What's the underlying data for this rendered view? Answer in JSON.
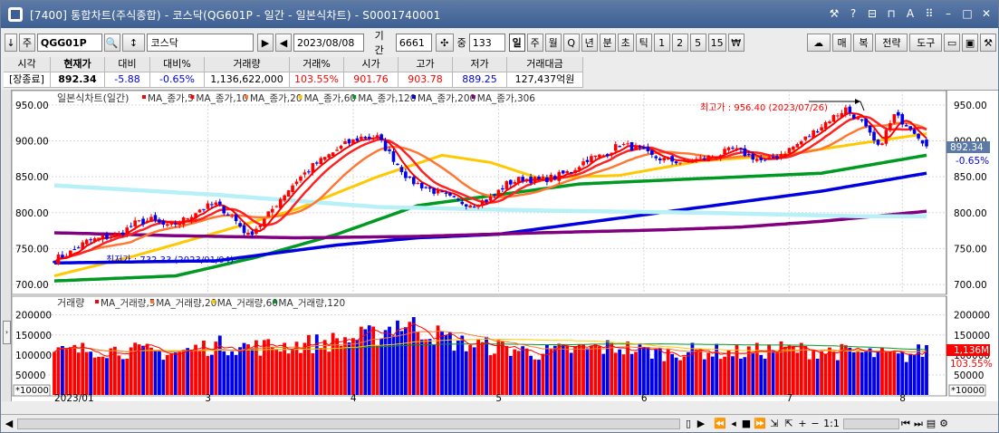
{
  "window": {
    "title": "[7400] 통합차트(주식종합) - 코스닥(QG601P - 일간 - 일본식차트) - S0001740001",
    "title_buttons": [
      "⚒",
      "?",
      "⊟",
      "⊓",
      "A",
      "⠿",
      "–",
      "□",
      "✕"
    ]
  },
  "toolbar": {
    "left_buttons": [
      "↓",
      "주"
    ],
    "code": "QGG01P",
    "search_icon": "🔍",
    "sort_icon": "↕",
    "name": "코스닥",
    "play_next": "▶",
    "play_prev": "◀",
    "date": "2023/08/08",
    "period_label": "기간",
    "period_value": "6661",
    "count_label": "중",
    "count_value": "133",
    "period_types": [
      "일",
      "주",
      "월",
      "Q",
      "년",
      "분",
      "초",
      "틱",
      "1",
      "2",
      "5",
      "15",
      "₩"
    ],
    "selected_period": "일",
    "right_buttons": [
      "매",
      "복",
      "전략",
      "도구"
    ]
  },
  "info": {
    "headers": [
      "시각",
      "현재가",
      "대비",
      "대비%",
      "거래량",
      "거래%",
      "시가",
      "고가",
      "저가",
      "거래대금"
    ],
    "values": [
      "[장종료]",
      "892.34",
      "-5.88",
      "-0.65%",
      "1,136,622,000",
      "103.55%",
      "901.76",
      "903.78",
      "889.25",
      "127,437억원"
    ]
  },
  "chart": {
    "price_title": "일본식차트(일간)",
    "price_legend": [
      {
        "label": "MA_종가,5",
        "color": "#ff0000"
      },
      {
        "label": "MA_종가,10",
        "color": "#ff0000"
      },
      {
        "label": "MA_종가,20",
        "color": "#ff7733"
      },
      {
        "label": "MA_종가,60",
        "color": "#ffc800"
      },
      {
        "label": "MA_종가,120",
        "color": "#009a22"
      },
      {
        "label": "MA_종가,200",
        "color": "#0000e0"
      },
      {
        "label": "MA_종가,306",
        "color": "#800080"
      }
    ],
    "price_axis": [
      "950.00",
      "900.00",
      "850.00",
      "800.00",
      "750.00",
      "700.00"
    ],
    "price_axis_values": [
      950,
      900,
      850,
      800,
      750,
      700
    ],
    "high_label": "최고가 : 956.40 (2023/07/26)",
    "low_label": "최저가 : 732.33 (2023/01/04)",
    "current_price": "892.34",
    "current_change": "-0.65%",
    "volume_title": "거래량",
    "volume_legend": [
      {
        "label": "MA_거래량,5",
        "color": "#ff0000"
      },
      {
        "label": "MA_거래량,20",
        "color": "#ff7733"
      },
      {
        "label": "MA_거래량,60",
        "color": "#ffc800"
      },
      {
        "label": "MA_거래량,120",
        "color": "#009a22"
      }
    ],
    "volume_axis": [
      "200000",
      "150000",
      "100000",
      "50000"
    ],
    "volume_axis_values": [
      200000,
      150000,
      100000,
      50000
    ],
    "volume_unit": "*10000",
    "current_volume": "1,136M",
    "current_volume_pct": "103.55%",
    "x_labels": [
      "2023/01",
      "3",
      "4",
      "5",
      "6",
      "7",
      "8"
    ],
    "colors": {
      "up": "#ff0000",
      "down": "#0000ee",
      "current_box": "#5b7aa8"
    }
  },
  "chart_data": {
    "type": "candlestick+volume",
    "title": "일본식차트(일간)",
    "ylim": [
      690,
      965
    ],
    "price_keypoints": [
      [
        0,
        735
      ],
      [
        4,
        745
      ],
      [
        8,
        760
      ],
      [
        12,
        765
      ],
      [
        16,
        770
      ],
      [
        20,
        785
      ],
      [
        24,
        790
      ],
      [
        28,
        780
      ],
      [
        32,
        790
      ],
      [
        36,
        805
      ],
      [
        40,
        812
      ],
      [
        44,
        795
      ],
      [
        48,
        768
      ],
      [
        52,
        790
      ],
      [
        56,
        820
      ],
      [
        60,
        845
      ],
      [
        64,
        865
      ],
      [
        68,
        880
      ],
      [
        72,
        895
      ],
      [
        76,
        905
      ],
      [
        80,
        905
      ],
      [
        84,
        875
      ],
      [
        88,
        845
      ],
      [
        92,
        835
      ],
      [
        96,
        825
      ],
      [
        100,
        815
      ],
      [
        104,
        812
      ],
      [
        108,
        820
      ],
      [
        112,
        840
      ],
      [
        116,
        848
      ],
      [
        120,
        845
      ],
      [
        124,
        850
      ],
      [
        128,
        858
      ],
      [
        132,
        875
      ],
      [
        136,
        880
      ],
      [
        140,
        895
      ],
      [
        144,
        890
      ],
      [
        148,
        878
      ],
      [
        152,
        873
      ],
      [
        156,
        870
      ],
      [
        160,
        875
      ],
      [
        164,
        880
      ],
      [
        168,
        888
      ],
      [
        172,
        880
      ],
      [
        176,
        870
      ],
      [
        180,
        882
      ],
      [
        184,
        895
      ],
      [
        188,
        912
      ],
      [
        192,
        930
      ],
      [
        196,
        945
      ],
      [
        200,
        925
      ],
      [
        204,
        890
      ],
      [
        208,
        935
      ],
      [
        212,
        920
      ],
      [
        216,
        895
      ]
    ],
    "volume_keypoints": [
      [
        0,
        105000
      ],
      [
        10,
        115000
      ],
      [
        20,
        110000
      ],
      [
        30,
        105000
      ],
      [
        40,
        125000
      ],
      [
        50,
        120000
      ],
      [
        60,
        125000
      ],
      [
        70,
        135000
      ],
      [
        80,
        150000
      ],
      [
        85,
        180000
      ],
      [
        88,
        175000
      ],
      [
        92,
        160000
      ],
      [
        100,
        130000
      ],
      [
        110,
        120000
      ],
      [
        120,
        105000
      ],
      [
        130,
        115000
      ],
      [
        140,
        120000
      ],
      [
        150,
        105000
      ],
      [
        160,
        110000
      ],
      [
        170,
        105000
      ],
      [
        180,
        115000
      ],
      [
        190,
        110000
      ],
      [
        200,
        105000
      ],
      [
        210,
        95000
      ],
      [
        216,
        113600
      ]
    ],
    "ma_keypoints": {
      "MA_종가,60": [
        [
          0,
          712
        ],
        [
          20,
          740
        ],
        [
          40,
          772
        ],
        [
          60,
          805
        ],
        [
          80,
          850
        ],
        [
          96,
          880
        ],
        [
          108,
          870
        ],
        [
          120,
          848
        ],
        [
          140,
          852
        ],
        [
          160,
          872
        ],
        [
          180,
          880
        ],
        [
          200,
          897
        ],
        [
          216,
          910
        ]
      ],
      "MA_종가,120": [
        [
          0,
          705
        ],
        [
          30,
          712
        ],
        [
          50,
          738
        ],
        [
          70,
          770
        ],
        [
          90,
          810
        ],
        [
          110,
          825
        ],
        [
          130,
          840
        ],
        [
          150,
          845
        ],
        [
          170,
          850
        ],
        [
          190,
          855
        ],
        [
          216,
          880
        ]
      ],
      "MA_종가,200": [
        [
          0,
          730
        ],
        [
          40,
          733
        ],
        [
          70,
          755
        ],
        [
          90,
          765
        ],
        [
          110,
          770
        ],
        [
          130,
          785
        ],
        [
          150,
          800
        ],
        [
          170,
          815
        ],
        [
          190,
          830
        ],
        [
          216,
          855
        ]
      ],
      "MA_종가,306": [
        [
          0,
          772
        ],
        [
          30,
          768
        ],
        [
          60,
          765
        ],
        [
          90,
          767
        ],
        [
          120,
          772
        ],
        [
          150,
          776
        ],
        [
          170,
          780
        ],
        [
          190,
          788
        ],
        [
          216,
          802
        ]
      ],
      "trend_line": [
        [
          0,
          838
        ],
        [
          40,
          825
        ],
        [
          80,
          808
        ],
        [
          120,
          803
        ],
        [
          160,
          800
        ],
        [
          200,
          795
        ],
        [
          216,
          795
        ]
      ]
    },
    "last": {
      "open": 901.76,
      "high": 903.78,
      "low": 889.25,
      "close": 892.34
    }
  }
}
